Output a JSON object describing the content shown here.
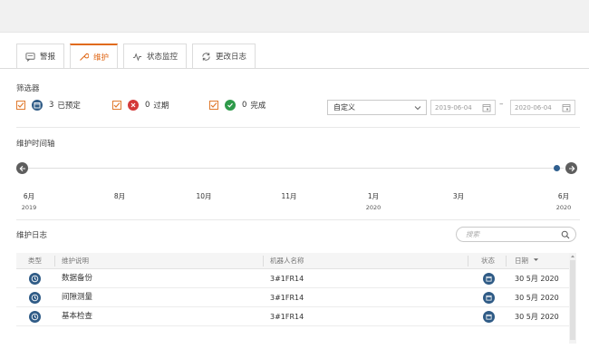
{
  "tabs": [
    {
      "label": "警报",
      "icon": "chat-icon",
      "active": false
    },
    {
      "label": "维护",
      "icon": "wrench-icon",
      "active": true
    },
    {
      "label": "状态监控",
      "icon": "pulse-icon",
      "active": false
    },
    {
      "label": "更改日志",
      "icon": "sync-icon",
      "active": false
    }
  ],
  "filter": {
    "title": "筛选器",
    "items": [
      {
        "count": "3",
        "label": "已预定",
        "color": "#2f5b86",
        "icon": "calendar-icon"
      },
      {
        "count": "0",
        "label": "过期",
        "color": "#d43a3a",
        "icon": "x-icon"
      },
      {
        "count": "0",
        "label": "完成",
        "color": "#2e9a4a",
        "icon": "check-icon"
      }
    ],
    "range_select": "自定义",
    "date_from": "2019-06-04",
    "date_sep": "–",
    "date_to": "2020-06-04"
  },
  "timeline": {
    "title": "维护时间轴",
    "ticks": [
      {
        "month": "6月",
        "year": "2019"
      },
      {
        "month": "8月",
        "year": ""
      },
      {
        "month": "10月",
        "year": ""
      },
      {
        "month": "11月",
        "year": ""
      },
      {
        "month": "1月",
        "year": "2020"
      },
      {
        "month": "3月",
        "year": ""
      },
      {
        "month": "6月",
        "year": "2020"
      }
    ]
  },
  "log": {
    "title": "维护日志",
    "search_placeholder": "搜索",
    "columns": {
      "type": "类型",
      "desc": "维护说明",
      "robot": "机器人名称",
      "status": "状态",
      "date": "日期"
    },
    "rows": [
      {
        "desc": "数据备份",
        "robot": "3#1FR14",
        "date": "30 5月 2020"
      },
      {
        "desc": "间隙测量",
        "robot": "3#1FR14",
        "date": "30 5月 2020"
      },
      {
        "desc": "基本检查",
        "robot": "3#1FR14",
        "date": "30 5月 2020"
      }
    ]
  },
  "colors": {
    "accent": "#e06a1b",
    "primary": "#2f5b86"
  }
}
